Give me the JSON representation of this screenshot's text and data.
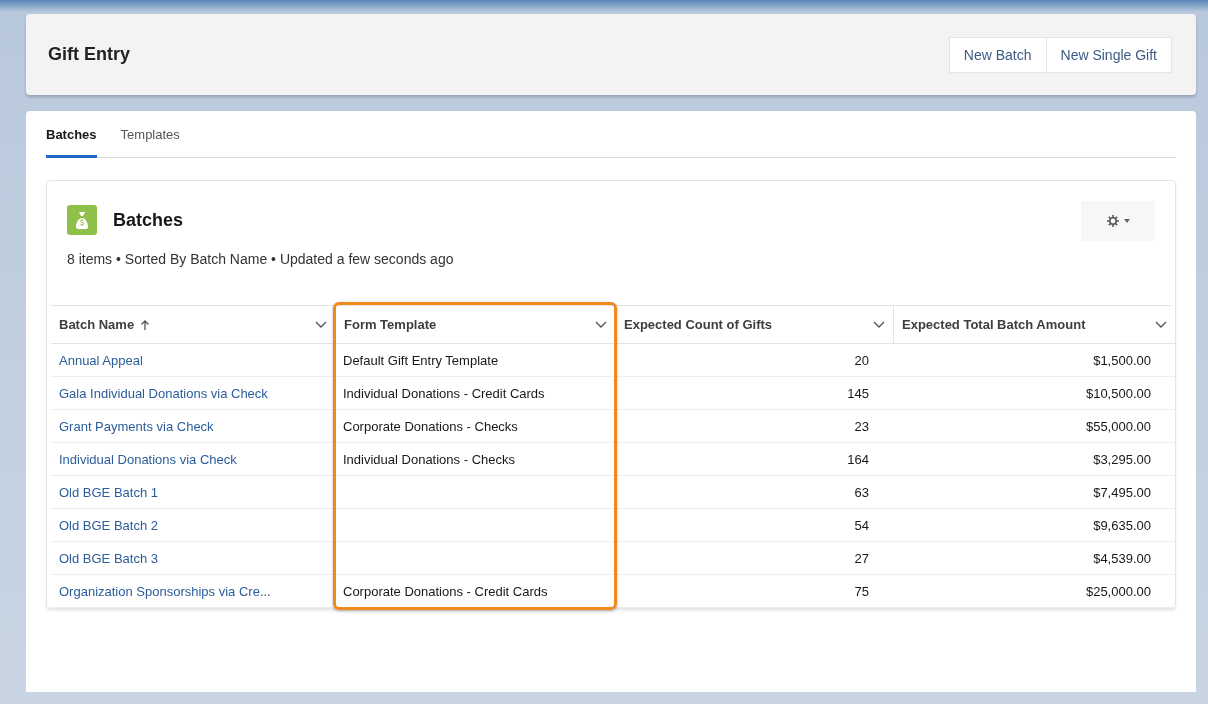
{
  "header": {
    "title": "Gift Entry",
    "buttons": [
      "New Batch",
      "New Single Gift"
    ]
  },
  "tabs": [
    {
      "label": "Batches",
      "selected": true
    },
    {
      "label": "Templates",
      "selected": false
    }
  ],
  "list": {
    "title": "Batches",
    "summary": "8 items • Sorted By Batch Name • Updated a few seconds ago",
    "columns": [
      {
        "label": "Batch Name",
        "kind": "link",
        "sorted": true,
        "highlighted": false
      },
      {
        "label": "Form Template",
        "kind": "text",
        "sorted": false,
        "highlighted": true
      },
      {
        "label": "Expected Count of Gifts",
        "kind": "number",
        "sorted": false,
        "highlighted": false
      },
      {
        "label": "Expected Total Batch Amount",
        "kind": "number",
        "sorted": false,
        "highlighted": false
      }
    ],
    "rows": [
      [
        "Annual Appeal",
        "Default Gift Entry Template",
        "20",
        "$1,500.00"
      ],
      [
        "Gala Individual Donations via Check",
        "Individual Donations - Credit Cards",
        "145",
        "$10,500.00"
      ],
      [
        "Grant Payments via Check",
        "Corporate Donations - Checks",
        "23",
        "$55,000.00"
      ],
      [
        "Individual Donations via Check",
        "Individual Donations - Checks",
        "164",
        "$3,295.00"
      ],
      [
        "Old BGE Batch 1",
        null,
        "63",
        "$7,495.00"
      ],
      [
        "Old BGE Batch 2",
        null,
        "54",
        "$9,635.00"
      ],
      [
        "Old BGE Batch 3",
        null,
        "27",
        "$4,539.00"
      ],
      [
        "Organization Sponsorships via Cre...",
        "Corporate Donations - Credit Cards",
        "75",
        "$25,000.00"
      ]
    ]
  }
}
